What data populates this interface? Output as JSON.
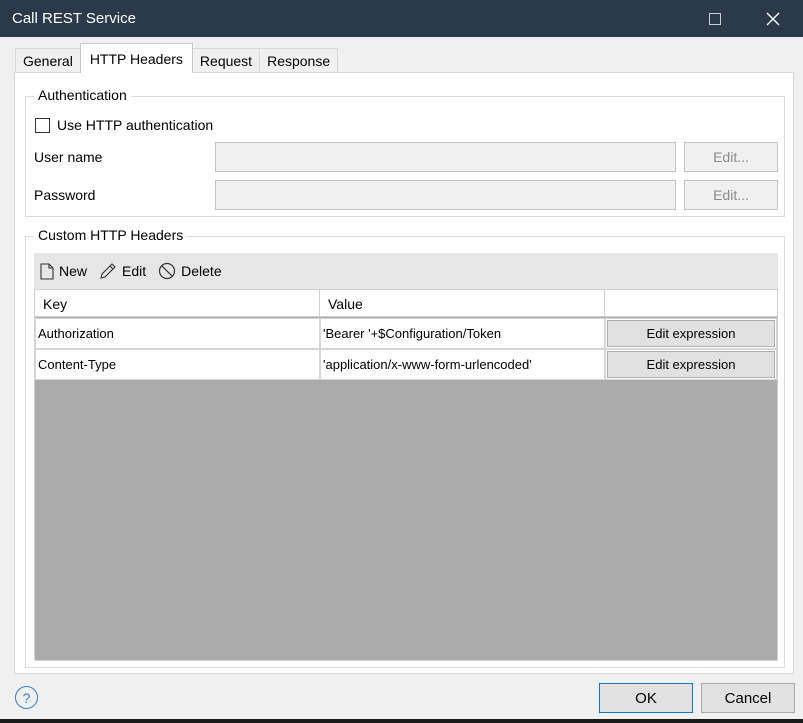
{
  "window": {
    "title": "Call REST Service"
  },
  "tabs": [
    {
      "label": "General",
      "active": false
    },
    {
      "label": "HTTP Headers",
      "active": true
    },
    {
      "label": "Request",
      "active": false
    },
    {
      "label": "Response",
      "active": false
    }
  ],
  "authentication": {
    "group_title": "Authentication",
    "use_auth_label": "Use HTTP authentication",
    "use_auth_checked": false,
    "username_label": "User name",
    "username_value": "",
    "password_label": "Password",
    "password_value": "",
    "edit_label": "Edit..."
  },
  "custom_headers": {
    "group_title": "Custom HTTP Headers",
    "toolbar": {
      "new_label": "New",
      "edit_label": "Edit",
      "delete_label": "Delete"
    },
    "columns": {
      "key": "Key",
      "value": "Value",
      "action": ""
    },
    "rows": [
      {
        "key": "Authorization",
        "value": "'Bearer '+$Configuration/Token",
        "action": "Edit expression"
      },
      {
        "key": "Content-Type",
        "value": "'application/x-www-form-urlencoded'",
        "action": "Edit expression"
      }
    ]
  },
  "footer": {
    "help_symbol": "?",
    "ok_label": "OK",
    "cancel_label": "Cancel"
  },
  "colors": {
    "titlebar": "#2b3a4a",
    "grid_empty": "#ababab",
    "accent": "#0078d7"
  }
}
